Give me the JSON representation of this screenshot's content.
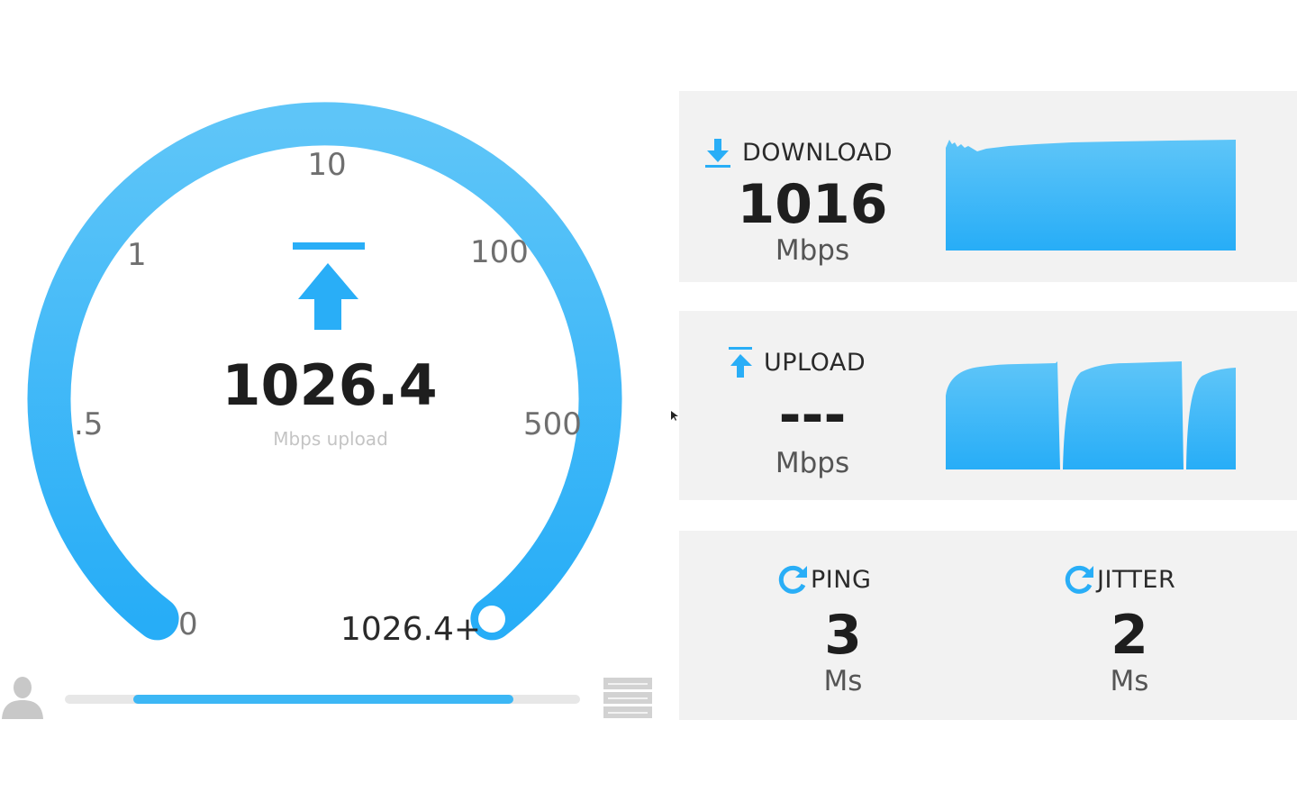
{
  "gauge": {
    "ticks": [
      "0",
      ".5",
      "1",
      "10",
      "100",
      "500"
    ],
    "value": "1026.4",
    "unit": "Mbps upload",
    "max_label": "1026.4+",
    "fill_fraction": 1.0
  },
  "progress": {
    "fraction": 0.87
  },
  "download": {
    "label": "DOWNLOAD",
    "value": "1016",
    "unit": "Mbps"
  },
  "upload": {
    "label": "UPLOAD",
    "value": "---",
    "unit": "Mbps"
  },
  "ping": {
    "label": "PING",
    "value": "3",
    "unit": "Ms"
  },
  "jitter": {
    "label": "JITTER",
    "value": "2",
    "unit": "Ms"
  },
  "colors": {
    "accent": "#29aef7",
    "accent_light": "#5ec5f8",
    "panel_bg": "#f2f2f2",
    "track": "#e7e7e7"
  },
  "icons": [
    "user-icon",
    "server-icon",
    "download-arrow-icon",
    "upload-arrow-icon",
    "refresh-icon",
    "mouse-cursor-icon"
  ]
}
